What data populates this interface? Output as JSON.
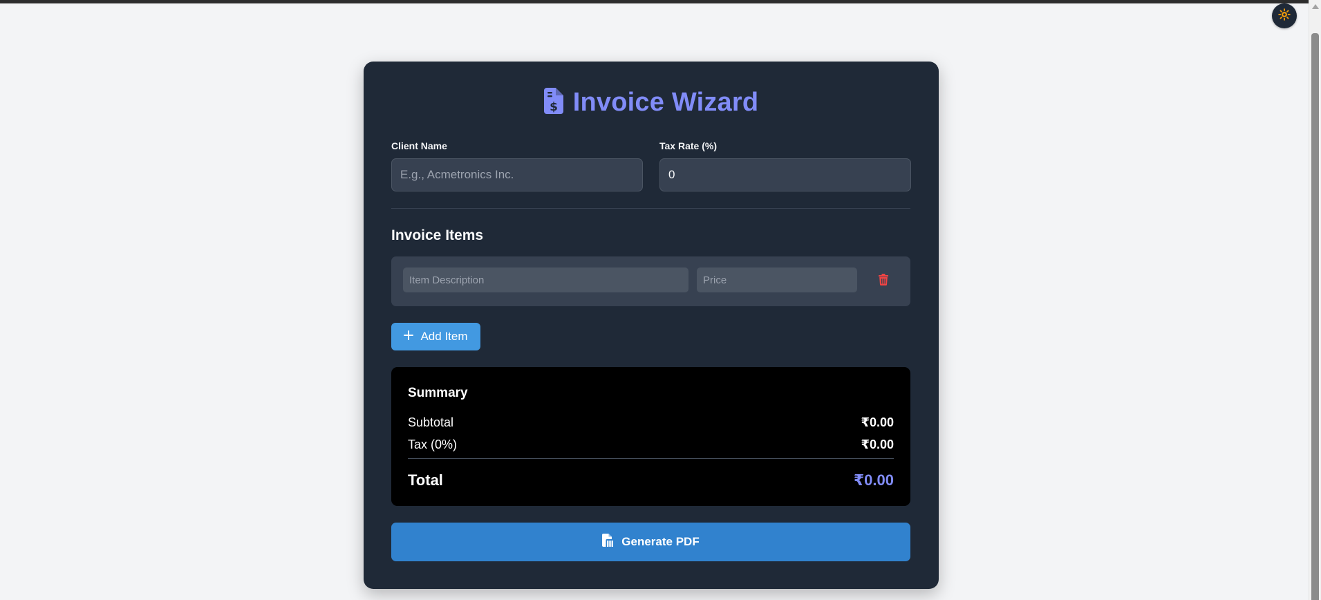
{
  "app": {
    "title": "Invoice Wizard",
    "accent_color": "#818cf8",
    "icons": {
      "title": "file-invoice-dollar-icon",
      "theme_toggle": "sun-icon",
      "delete": "trash-icon",
      "add": "plus-icon",
      "pdf": "file-pdf-icon"
    }
  },
  "form": {
    "client_name": {
      "label": "Client Name",
      "placeholder": "E.g., Acmetronics Inc.",
      "value": ""
    },
    "tax_rate": {
      "label": "Tax Rate (%)",
      "value": "0"
    }
  },
  "items": {
    "section_title": "Invoice Items",
    "rows": [
      {
        "description_placeholder": "Item Description",
        "price_placeholder": "Price",
        "description": "",
        "price": ""
      }
    ],
    "add_label": "Add Item"
  },
  "summary": {
    "title": "Summary",
    "subtotal_label": "Subtotal",
    "subtotal_value": "₹0.00",
    "tax_label": "Tax (0%)",
    "tax_value": "₹0.00",
    "total_label": "Total",
    "total_value": "₹0.00"
  },
  "actions": {
    "generate_pdf_label": "Generate PDF"
  }
}
